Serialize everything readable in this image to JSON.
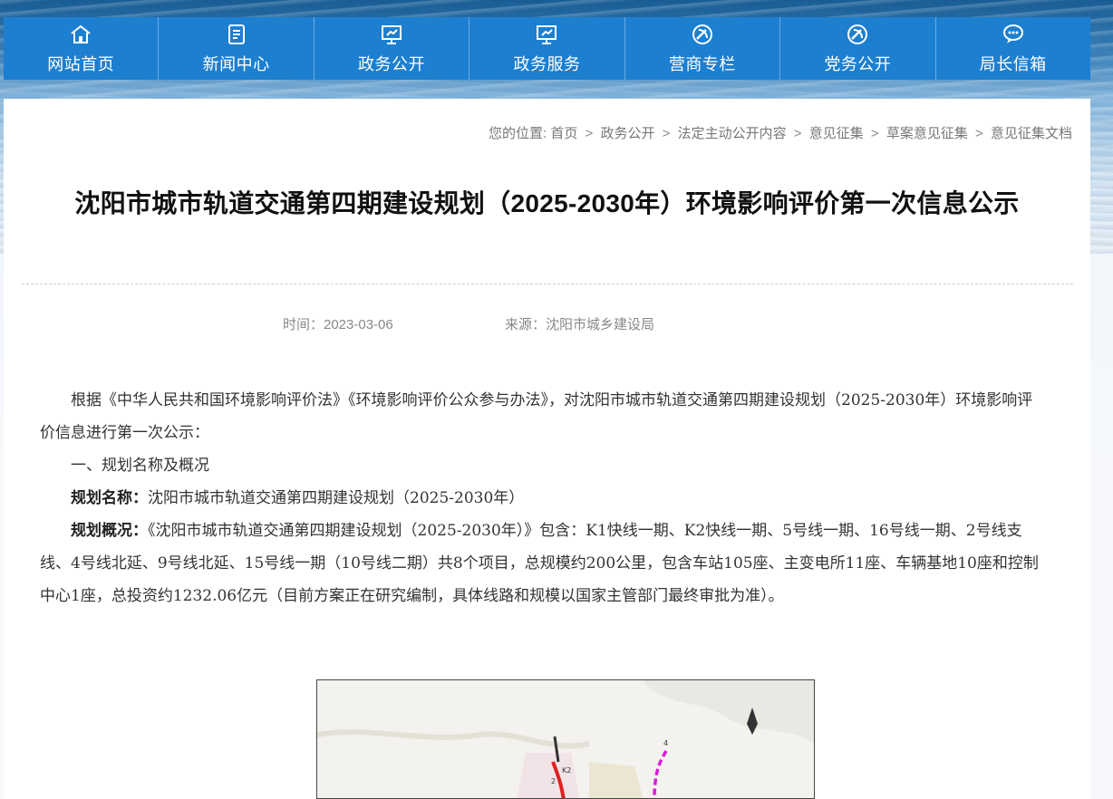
{
  "nav": [
    {
      "label": "网站首页",
      "icon": "home-icon"
    },
    {
      "label": "新闻中心",
      "icon": "news-icon"
    },
    {
      "label": "政务公开",
      "icon": "monitor-icon"
    },
    {
      "label": "政务服务",
      "icon": "monitor-icon"
    },
    {
      "label": "营商专栏",
      "icon": "party-emblem-icon"
    },
    {
      "label": "党务公开",
      "icon": "party-emblem-icon"
    },
    {
      "label": "局长信箱",
      "icon": "chat-icon"
    }
  ],
  "breadcrumb": {
    "prefix": "您的位置:",
    "items": [
      "首页",
      "政务公开",
      "法定主动公开内容",
      "意见征集",
      "草案意见征集",
      "意见征集文档"
    ],
    "separator": ">"
  },
  "article": {
    "title": "沈阳市城市轨道交通第四期建设规划（2025-2030年）环境影响评价第一次信息公示",
    "time": "时间：2023-03-06",
    "source": "来源：沈阳市城乡建设局",
    "para1": "根据《中华人民共和国环境影响评价法》《环境影响评价公众参与办法》，对沈阳市城市轨道交通第四期建设规划（2025-2030年）环境影响评价信息进行第一次公示：",
    "section1": "一、规划名称及概况",
    "name_label": "规划名称：",
    "name_value": "沈阳市城市轨道交通第四期建设规划（2025-2030年）",
    "overview_label": "规划概况：",
    "overview_value": "《沈阳市城市轨道交通第四期建设规划（2025-2030年）》包含：K1快线一期、K2快线一期、5号线一期、16号线一期、2号线支线、4号线北延、9号线北延、15号线一期（10号线二期）共8个项目，总规模约200公里，包含车站105座、主变电所11座、车辆基地10座和控制中心1座，总投资约1232.06亿元（目前方案正在研究编制，具体线路和规模以国家主管部门最终审批为准）。"
  },
  "map": {
    "labels": [
      "K2",
      "2",
      "4"
    ],
    "colors": {
      "line_red": "#e02020",
      "line_magenta": "#d81bd8",
      "line_dark": "#333333"
    }
  },
  "colors": {
    "nav_bg": "#1d7fd0",
    "title": "#111111",
    "text": "#333333"
  }
}
